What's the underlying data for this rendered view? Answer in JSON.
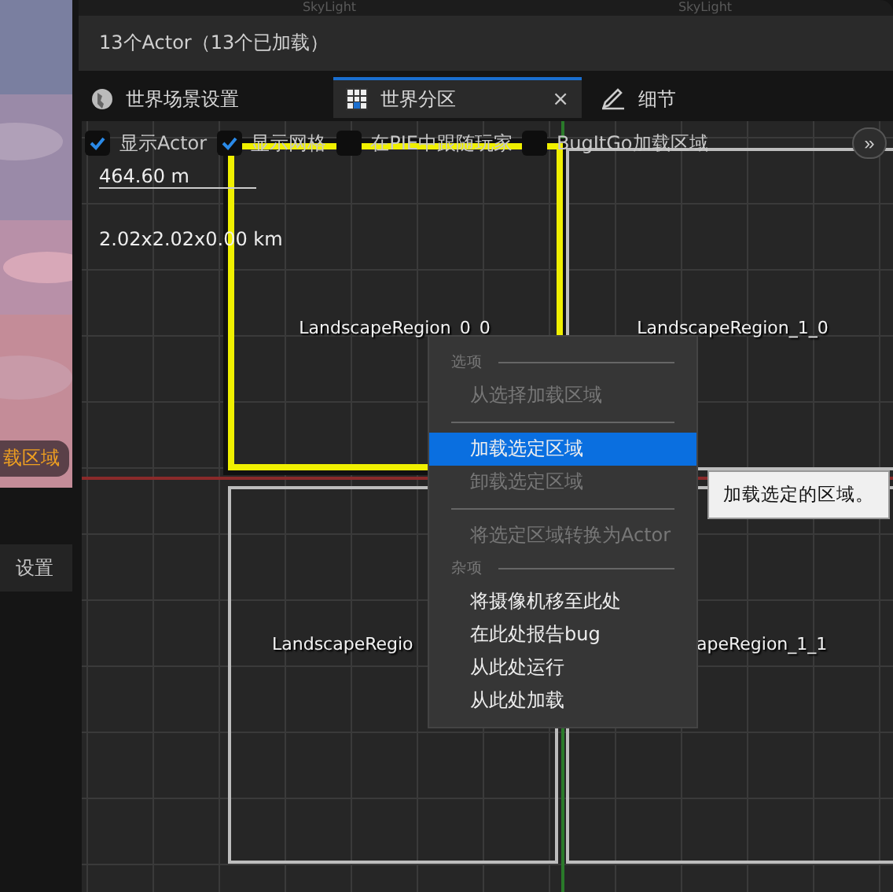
{
  "top_bar": {
    "labels": [
      "SkyLight",
      "SkyLight"
    ]
  },
  "sidebar": {
    "badge": "载区域",
    "tab": "设置"
  },
  "outliner": {
    "summary": "13个Actor（13个已加载）"
  },
  "tabs": [
    {
      "label": "世界场景设置",
      "selected": false
    },
    {
      "label": "世界分区",
      "selected": true,
      "close": "×"
    },
    {
      "label": "细节",
      "selected": false
    }
  ],
  "toolbar": {
    "options": [
      {
        "label": "显示Actor",
        "checked": true
      },
      {
        "label": "显示网格",
        "checked": true
      },
      {
        "label": "在PIE中跟随玩家",
        "checked": false
      },
      {
        "label": "BugItGo加载区域",
        "checked": false
      }
    ],
    "overflow": "»"
  },
  "viewport": {
    "scale": "464.60 m",
    "size": "2.02x2.02x0.00 km",
    "regions": [
      {
        "label": "LandscapeRegion_0_0",
        "selected": true
      },
      {
        "label": "LandscapeRegion_1_0",
        "selected": false
      },
      {
        "label": "LandscapeRegio",
        "selected": false
      },
      {
        "label": "apeRegion_1_1",
        "selected": false
      }
    ]
  },
  "context_menu": {
    "sections": [
      {
        "header": "选项",
        "items": [
          {
            "label": "从选择加载区域",
            "disabled": true,
            "selected": false
          }
        ]
      },
      {
        "items": [
          {
            "label": "加载选定区域",
            "disabled": false,
            "selected": true
          },
          {
            "label": "卸载选定区域",
            "disabled": true,
            "selected": false
          }
        ]
      },
      {
        "items": [
          {
            "label": "将选定区域转换为Actor",
            "disabled": true,
            "selected": false
          }
        ]
      },
      {
        "header": "杂项",
        "items": [
          {
            "label": "将摄像机移至此处",
            "disabled": false,
            "selected": false
          },
          {
            "label": "在此处报告bug",
            "disabled": false,
            "selected": false
          },
          {
            "label": "从此处运行",
            "disabled": false,
            "selected": false
          },
          {
            "label": "从此处加载",
            "disabled": false,
            "selected": false
          }
        ]
      }
    ]
  },
  "tooltip": "加载选定的区域。"
}
